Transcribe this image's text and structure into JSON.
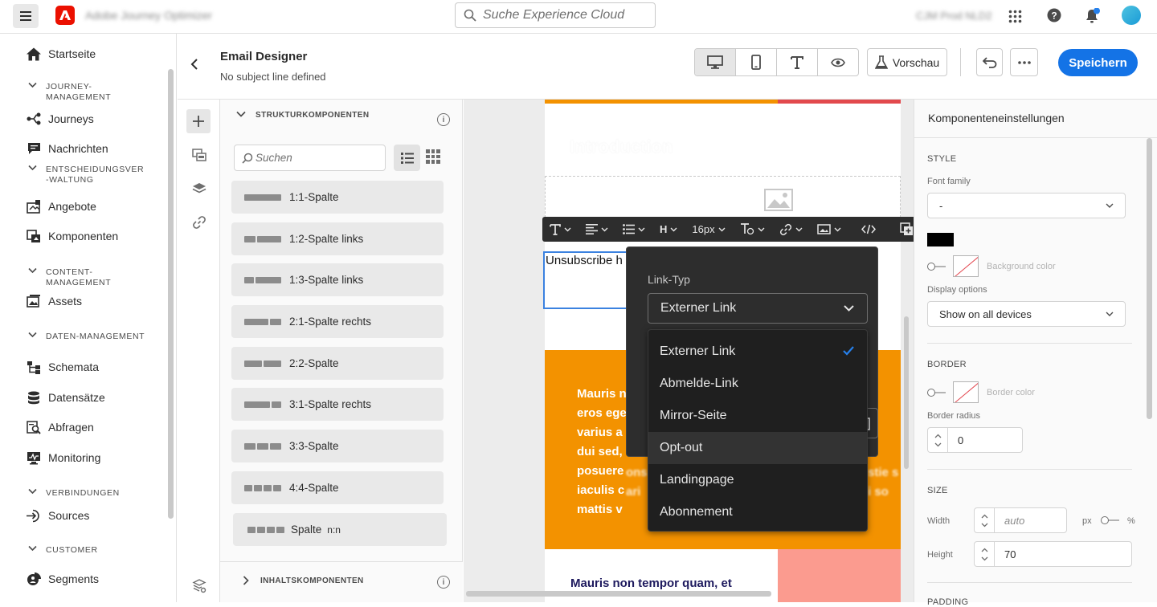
{
  "topbar": {
    "app_name": "Adobe Journey Optimizer",
    "search_placeholder": "Suche Experience Cloud",
    "org_name": "CJM Prod NLD2"
  },
  "nav": {
    "home": "Startseite",
    "journey_mgmt": "JOURNEY-MANAGEMENT",
    "journeys": "Journeys",
    "messages": "Nachrichten",
    "decision_mgmt": "ENTSCHEIDUNGSVER-WALTUNG",
    "offers": "Angebote",
    "components": "Komponenten",
    "content_mgmt": "CONTENT-MANAGEMENT",
    "assets": "Assets",
    "data_mgmt": "DATEN-MANAGEMENT",
    "schemas": "Schemata",
    "datasets": "Datensätze",
    "queries": "Abfragen",
    "monitoring": "Monitoring",
    "connections": "VERBINDUNGEN",
    "sources": "Sources",
    "customer": "CUSTOMER",
    "segments": "Segments"
  },
  "header": {
    "title": "Email Designer",
    "subtitle": "No subject line defined",
    "preview": "Vorschau",
    "save": "Speichern"
  },
  "components_panel": {
    "structure_title": "STRUKTURKOMPONENTEN",
    "search_placeholder": "Suchen",
    "items": [
      "1:1-Spalte",
      "1:2-Spalte links",
      "1:3-Spalte links",
      "2:1-Spalte rechts",
      "2:2-Spalte",
      "3:1-Spalte rechts",
      "3:3-Spalte",
      "4:4-Spalte",
      "Spalte",
      "n:n"
    ],
    "content_title": "INHALTSKOMPONENTEN"
  },
  "canvas": {
    "introduction": "Introduction",
    "unsubscribe": "Unsubscribe h",
    "orange_lines": [
      "Mauris n",
      "eros ege",
      "varius a",
      "dui sed,",
      "posuere",
      "iaculis c",
      "mattis v"
    ],
    "overlay_left": [
      "ons",
      "ari"
    ],
    "overlay_right": [
      "stie s",
      "i so"
    ],
    "bottom_text": "Mauris non tempor quam, et"
  },
  "toolbar": {
    "font_size": "16px",
    "heading": "H"
  },
  "link_popover": {
    "label": "Link-Typ",
    "selected": "Externer Link",
    "options": [
      "Externer Link",
      "Abmelde-Link",
      "Mirror-Seite",
      "Opt-out",
      "Landingpage",
      "Abonnement"
    ]
  },
  "settings": {
    "title": "Komponenteneinstellungen",
    "style": "STYLE",
    "font_family_label": "Font family",
    "font_family_value": "-",
    "background_color": "Background color",
    "display_options_label": "Display options",
    "display_options_value": "Show on all devices",
    "border": "BORDER",
    "border_color": "Border color",
    "border_radius_label": "Border radius",
    "border_radius_value": "0",
    "size": "SIZE",
    "width_label": "Width",
    "width_placeholder": "auto",
    "unit_px": "px",
    "unit_pct": "%",
    "height_label": "Height",
    "height_value": "70",
    "padding": "PADDING"
  },
  "colors": {
    "accent": "#1473e6",
    "orange": "#f39200",
    "coral": "#e2494d",
    "salmon": "#fb9b8f"
  }
}
